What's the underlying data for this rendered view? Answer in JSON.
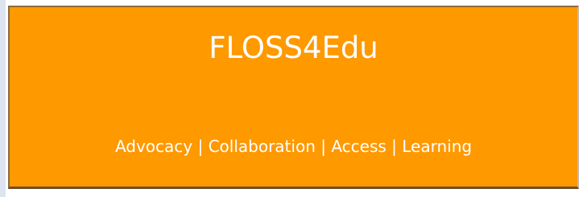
{
  "banner": {
    "title": "FLOSS4Edu",
    "tagline": "Advocacy | Collaboration | Access | Learning"
  },
  "colors": {
    "banner_background": "#ff9900",
    "banner_text": "#ffffff",
    "banner_border": "#8c6a3c",
    "page_background": "#ffffff",
    "left_rail": "#dde3f0"
  }
}
